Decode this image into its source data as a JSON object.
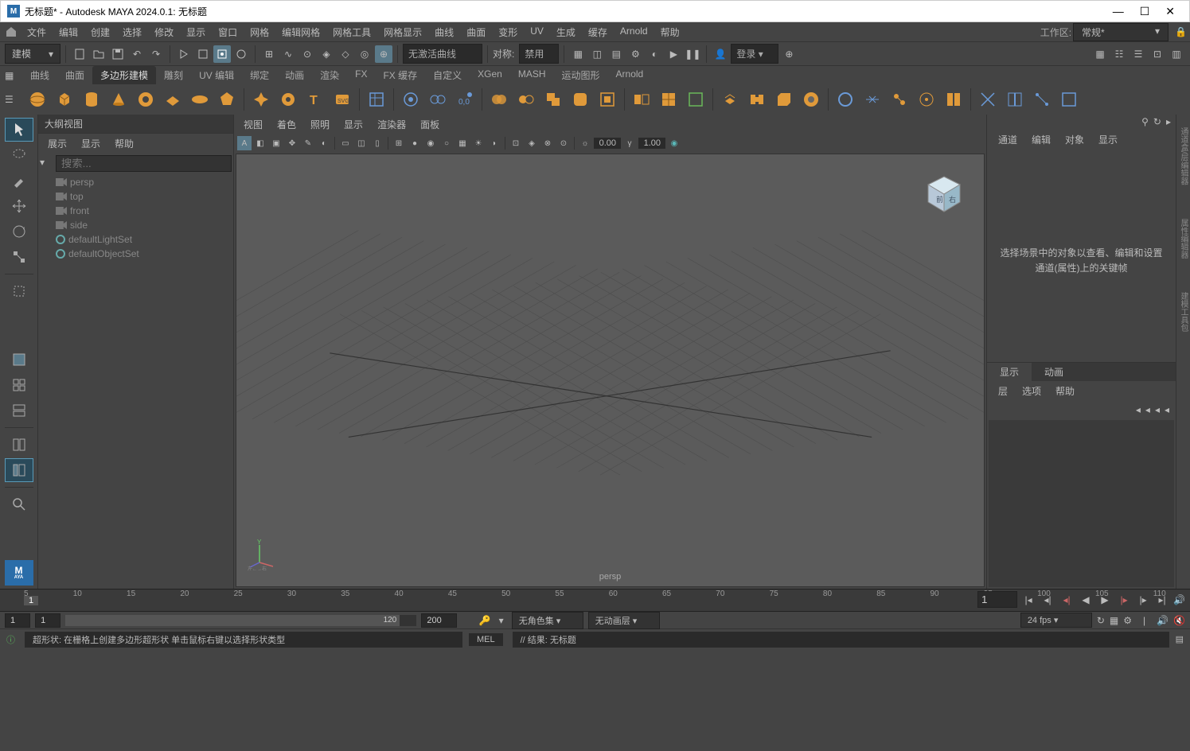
{
  "title": "无标题* - Autodesk MAYA 2024.0.1: 无标题",
  "menubar": {
    "items": [
      "文件",
      "编辑",
      "创建",
      "选择",
      "修改",
      "显示",
      "窗口",
      "网格",
      "编辑网格",
      "网格工具",
      "网格显示",
      "曲线",
      "曲面",
      "变形",
      "UV",
      "生成",
      "缓存",
      "Arnold",
      "帮助"
    ],
    "workspace_label": "工作区:",
    "workspace_value": "常规*"
  },
  "toolbar": {
    "mode": "建模",
    "no_active_curve": "无激活曲线",
    "symmetry_label": "对称:",
    "symmetry_value": "禁用",
    "login": "登录"
  },
  "shelf_tabs": [
    "曲线",
    "曲面",
    "多边形建模",
    "雕刻",
    "UV 编辑",
    "绑定",
    "动画",
    "渲染",
    "FX",
    "FX 缓存",
    "自定义",
    "XGen",
    "MASH",
    "运动图形",
    "Arnold"
  ],
  "active_shelf_tab": "多边形建模",
  "outliner": {
    "title": "大纲视图",
    "menu": [
      "展示",
      "显示",
      "帮助"
    ],
    "search_placeholder": "搜索...",
    "items": [
      {
        "name": "persp",
        "type": "camera"
      },
      {
        "name": "top",
        "type": "camera"
      },
      {
        "name": "front",
        "type": "camera"
      },
      {
        "name": "side",
        "type": "camera"
      },
      {
        "name": "defaultLightSet",
        "type": "set"
      },
      {
        "name": "defaultObjectSet",
        "type": "set"
      }
    ]
  },
  "viewport": {
    "menu": [
      "视图",
      "着色",
      "照明",
      "显示",
      "渲染器",
      "面板"
    ],
    "camera_label": "persp",
    "field1": "0.00",
    "field2": "1.00"
  },
  "right_panel": {
    "tabs": [
      "通道",
      "编辑",
      "对象",
      "显示"
    ],
    "hint": "选择场景中的对象以查看、编辑和设置通道(属性)上的关键帧",
    "layer_tabs": [
      "显示",
      "动画"
    ],
    "layer_menu": [
      "层",
      "选项",
      "帮助"
    ]
  },
  "side_tabs": [
    "通道盒/层编辑器",
    "属性编辑器",
    "建模工具包"
  ],
  "timeline": {
    "current_frame": "1",
    "ticks": [
      "5",
      "10",
      "15",
      "20",
      "25",
      "30",
      "35",
      "40",
      "45",
      "50",
      "55",
      "60",
      "65",
      "70",
      "75",
      "80",
      "85",
      "90",
      "95",
      "100",
      "105",
      "110"
    ],
    "cur_field": "1"
  },
  "range": {
    "start": "1",
    "range_start": "1",
    "range_end": "120",
    "end": "200",
    "charset": "无角色集",
    "animlayer": "无动画层",
    "fps": "24 fps"
  },
  "status": {
    "message": "超形状: 在栅格上创建多边形超形状  单击鼠标右键以选择形状类型",
    "mel": "MEL",
    "result_label": "结果:",
    "result_value": "无标题"
  }
}
